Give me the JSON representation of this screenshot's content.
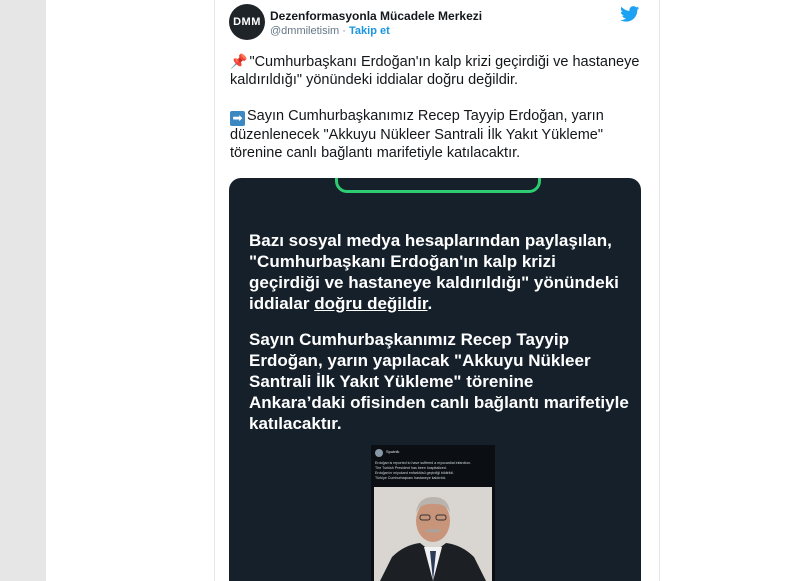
{
  "tweet": {
    "author_name": "Dezenformasyonla Mücadele Merkezi",
    "handle": "@dmmiletisim",
    "separator": "·",
    "follow_label": "Takip et",
    "avatar_text": "DMM",
    "text_p1": "\"Cumhurbaşkanı Erdoğan'ın kalp krizi geçirdiği ve hastaneye kaldırıldığı\" yönündeki iddialar doğru değildir.",
    "text_p2": "Sayın Cumhurbaşkanımız Recep Tayyip Erdoğan, yarın düzenlenecek \"Akkuyu Nükleer Santrali İlk Yakıt Yükleme\" törenine canlı bağlantı marifetiyle katılacaktır.",
    "icons": [
      "pushpin-icon",
      "right-arrow-icon",
      "twitter-bird-icon"
    ],
    "accent_color": "#1b95e0"
  },
  "media": {
    "para1_prefix": "Bazı sosyal medya hesaplarından paylaşılan, \"Cumhurbaşkanı Erdoğan'ın kalp krizi geçirdiği ve hastaneye kaldırıldığı\" yönündeki iddialar ",
    "para1_underlined": "doğru değildir",
    "para1_suffix": ".",
    "para2": "Sayın Cumhurbaşkanımız Recep Tayyip Erdoğan, yarın yapılacak \"Akkuyu Nükleer Santrali İlk Yakıt Yükleme\" törenine Ankara’daki ofisinden canlı bağlantı marifetiyle katılacaktır.",
    "background_color": "#15202b",
    "highlight_color": "#2ecc71",
    "inner_tweet": {
      "author": "Sputnik",
      "line1": "Erdoğan is reported to have suffered a myocardial infarction.",
      "line2": "The Turkish President has been hospitalized.",
      "line3": "Erdoğan'ın miyokard enfarktüsü geçirdiği bildirildi.",
      "line4": "Türkiye Cumhurbaşkanı hastaneye kaldırıldı."
    }
  }
}
